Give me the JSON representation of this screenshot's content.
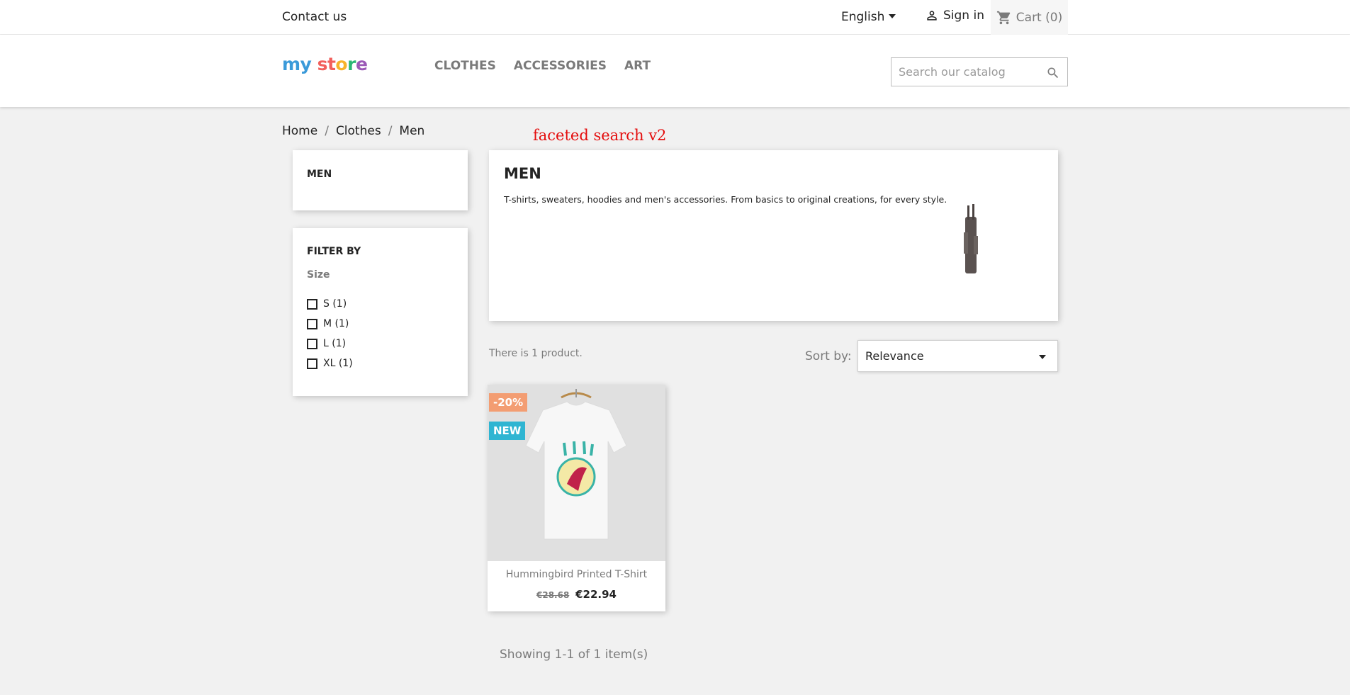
{
  "topbar": {
    "contact": "Contact us",
    "language": "English",
    "signin": "Sign in",
    "cart": "Cart (0)"
  },
  "header": {
    "logo": {
      "part1": "my",
      "part2": "st",
      "part3": "o",
      "part4": "r",
      "part5": "e"
    },
    "nav": [
      "CLOTHES",
      "ACCESSORIES",
      "ART"
    ],
    "search_placeholder": "Search our catalog"
  },
  "breadcrumb": [
    "Home",
    "Clothes",
    "Men"
  ],
  "annotation": "faceted search v2",
  "sidebar": {
    "category": "MEN",
    "filter_title": "FILTER BY",
    "facet_label": "Size",
    "facets": [
      "S (1)",
      "M (1)",
      "L (1)",
      "XL (1)"
    ]
  },
  "category": {
    "title": "MEN",
    "description": "T-shirts, sweaters, hoodies and men's accessories. From basics to original creations, for every style."
  },
  "listing": {
    "count": "There is 1 product.",
    "sort_label": "Sort by:",
    "sort_value": "Relevance",
    "showing": "Showing 1-1 of 1 item(s)"
  },
  "product": {
    "discount_flag": "-20%",
    "new_flag": "NEW",
    "name": "Hummingbird Printed T-Shirt",
    "old_price": "€28.68",
    "price": "€22.94"
  }
}
